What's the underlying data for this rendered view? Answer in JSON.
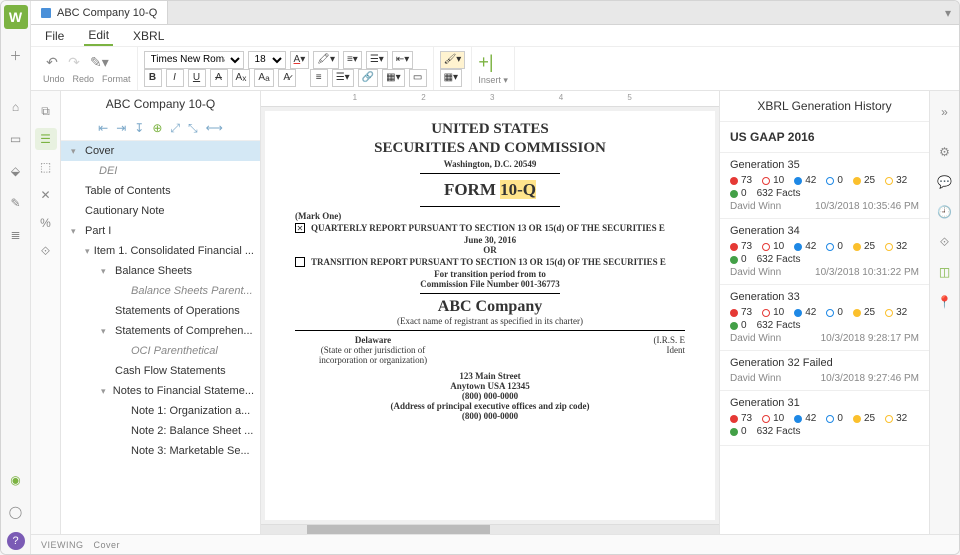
{
  "tab": {
    "title": "ABC Company 10-Q"
  },
  "menu": {
    "file": "File",
    "edit": "Edit",
    "xbrl": "XBRL"
  },
  "toolbar": {
    "undo": "Undo",
    "redo": "Redo",
    "format": "Format",
    "font": "Times New Roman",
    "size": "18",
    "insert": "Insert"
  },
  "outline": {
    "title": "ABC Company 10-Q",
    "items": [
      {
        "label": "Cover",
        "selected": true,
        "chev": "▾"
      },
      {
        "label": "DEI",
        "indent": 1,
        "italic": true
      },
      {
        "label": "Table of Contents"
      },
      {
        "label": "Cautionary Note"
      },
      {
        "label": "Part I",
        "chev": "▾"
      },
      {
        "label": "Item 1. Consolidated Financial ...",
        "indent": 1,
        "chev": "▾"
      },
      {
        "label": "Balance Sheets",
        "indent": 2,
        "chev": "▾"
      },
      {
        "label": "Balance Sheets Parent...",
        "indent": 3,
        "italic": true
      },
      {
        "label": "Statements of Operations",
        "indent": 2
      },
      {
        "label": "Statements of Comprehen...",
        "indent": 2,
        "chev": "▾"
      },
      {
        "label": "OCI Parenthetical",
        "indent": 3,
        "italic": true
      },
      {
        "label": "Cash Flow Statements",
        "indent": 2
      },
      {
        "label": "Notes to Financial Stateme...",
        "indent": 2,
        "chev": "▾"
      },
      {
        "label": "Note 1: Organization a...",
        "indent": 3
      },
      {
        "label": "Note 2: Balance Sheet ...",
        "indent": 3
      },
      {
        "label": "Note 3: Marketable Se...",
        "indent": 3
      }
    ]
  },
  "doc": {
    "h1a": "UNITED STATES",
    "h1b": "SECURITIES AND COMMISSION",
    "sub": "Washington, D.C. 20549",
    "form_prefix": "FORM ",
    "form_num": "10-Q",
    "markone": "(Mark One)",
    "opt1": "QUARTERLY REPORT PURSUANT TO SECTION 13 OR 15(d) OF THE SECURITIES E",
    "date": "June 30, 2016",
    "or": "OR",
    "opt2": "TRANSITION REPORT PURSUANT TO SECTION 13 OR 15(d) OF THE SECURITIES E",
    "trans_period": "For transition period from               to",
    "filenum": "Commission File Number 001-36773",
    "company": "ABC Company",
    "exactname": "(Exact name of registrant as specified in its charter)",
    "state": "Delaware",
    "state_sub": "(State or other jurisdiction of\nincorporation or organization)",
    "irs": "(I.R.S. E\nIdent",
    "addr1": "123 Main Street",
    "addr2": "Anytown USA 12345",
    "addr3": "(800) 000-0000",
    "addr_sub": "(Address of principal executive offices and zip code)",
    "phone2": "(800) 000-0000"
  },
  "history": {
    "title": "XBRL Generation History",
    "gaap": "US GAAP 2016",
    "gens": [
      {
        "title": "Generation 35",
        "user": "David Winn",
        "ts": "10/3/2018 10:35:46 PM",
        "dots": [
          {
            "c": "#e53935",
            "v": "73"
          },
          {
            "c": "#e53935",
            "v": "10",
            "open": true
          },
          {
            "c": "#1e88e5",
            "v": "42"
          },
          {
            "c": "#1e88e5",
            "v": "0",
            "open": true
          },
          {
            "c": "#fbc02d",
            "v": "25"
          },
          {
            "c": "#fbc02d",
            "v": "32",
            "open": true
          },
          {
            "c": "#43a047",
            "v": "0"
          },
          {
            "text": "632 Facts"
          }
        ]
      },
      {
        "title": "Generation 34",
        "user": "David Winn",
        "ts": "10/3/2018 10:31:22 PM",
        "dots": [
          {
            "c": "#e53935",
            "v": "73"
          },
          {
            "c": "#e53935",
            "v": "10",
            "open": true
          },
          {
            "c": "#1e88e5",
            "v": "42"
          },
          {
            "c": "#1e88e5",
            "v": "0",
            "open": true
          },
          {
            "c": "#fbc02d",
            "v": "25"
          },
          {
            "c": "#fbc02d",
            "v": "32",
            "open": true
          },
          {
            "c": "#43a047",
            "v": "0"
          },
          {
            "text": "632 Facts"
          }
        ]
      },
      {
        "title": "Generation 33",
        "user": "David Winn",
        "ts": "10/3/2018 9:28:17 PM",
        "dots": [
          {
            "c": "#e53935",
            "v": "73"
          },
          {
            "c": "#e53935",
            "v": "10",
            "open": true
          },
          {
            "c": "#1e88e5",
            "v": "42"
          },
          {
            "c": "#1e88e5",
            "v": "0",
            "open": true
          },
          {
            "c": "#fbc02d",
            "v": "25"
          },
          {
            "c": "#fbc02d",
            "v": "32",
            "open": true
          },
          {
            "c": "#43a047",
            "v": "0"
          },
          {
            "text": "632 Facts"
          }
        ]
      },
      {
        "title": "Generation 32 Failed",
        "user": "David Winn",
        "ts": "10/3/2018 9:27:46 PM",
        "dots": []
      },
      {
        "title": "Generation 31",
        "dots": [
          {
            "c": "#e53935",
            "v": "73"
          },
          {
            "c": "#e53935",
            "v": "10",
            "open": true
          },
          {
            "c": "#1e88e5",
            "v": "42"
          },
          {
            "c": "#1e88e5",
            "v": "0",
            "open": true
          },
          {
            "c": "#fbc02d",
            "v": "25"
          },
          {
            "c": "#fbc02d",
            "v": "32",
            "open": true
          },
          {
            "c": "#43a047",
            "v": "0"
          },
          {
            "text": "632 Facts"
          }
        ]
      }
    ]
  },
  "status": {
    "mode": "VIEWING",
    "section": "Cover"
  }
}
